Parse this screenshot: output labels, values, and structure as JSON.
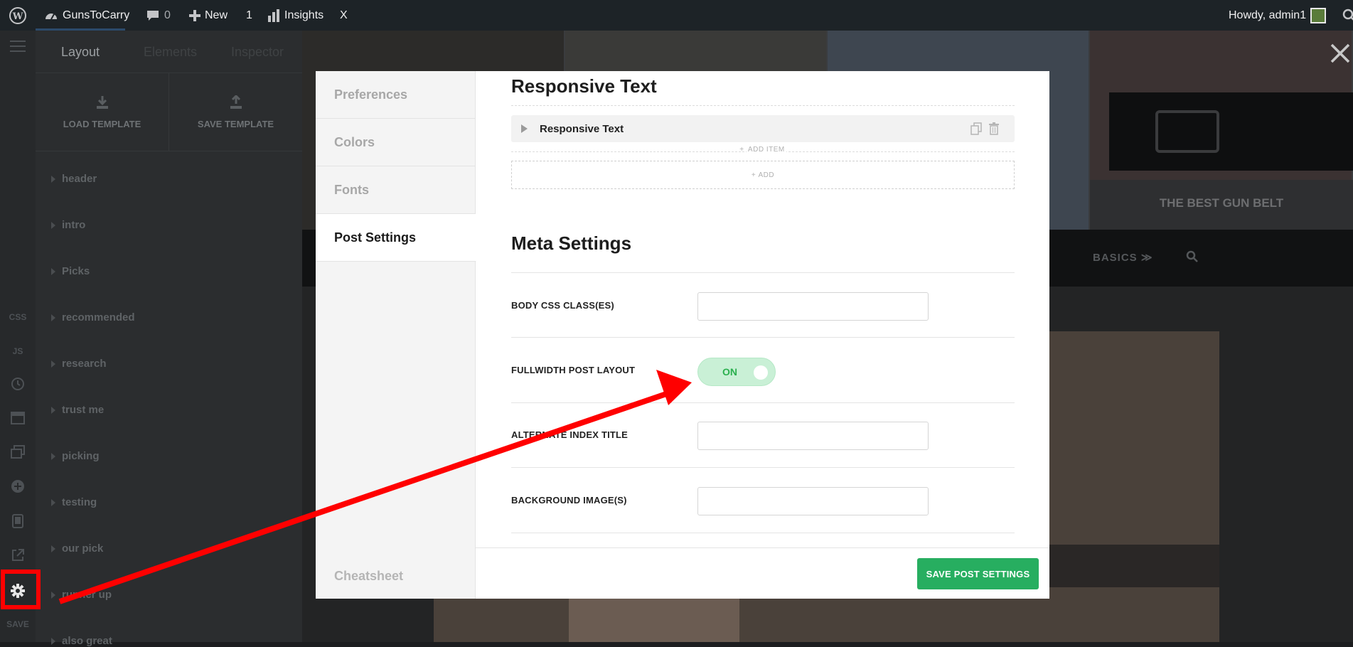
{
  "adminbar": {
    "site_name": "GunsToCarry",
    "comments_count": "0",
    "new_label": "New",
    "updates_count": "1",
    "insights_label": "Insights",
    "x_label": "X",
    "howdy": "Howdy, admin1"
  },
  "rail": {
    "css_label": "CSS",
    "js_label": "JS",
    "save_label": "SAVE"
  },
  "sidebar": {
    "tabs": [
      "Layout",
      "Elements",
      "Inspector"
    ],
    "load_template": "LOAD TEMPLATE",
    "save_template": "SAVE TEMPLATE",
    "items": [
      "header",
      "intro",
      "Picks",
      "recommended",
      "research",
      "trust me",
      "picking",
      "testing",
      "our pick",
      "runner up",
      "also great"
    ]
  },
  "background_page": {
    "hero_caption": "THE BEST GUN BELT",
    "nav_basics": "BASICS"
  },
  "modal": {
    "nav": [
      "Preferences",
      "Colors",
      "Fonts",
      "Post Settings"
    ],
    "active_nav": "Post Settings",
    "cheatsheet": "Cheatsheet",
    "responsive_heading": "Responsive Text",
    "responsive_item": "Responsive Text",
    "add_item": "ADD ITEM",
    "add": "ADD",
    "meta_heading": "Meta Settings",
    "fields": {
      "body_css": {
        "label": "BODY CSS CLASS(ES)",
        "value": ""
      },
      "fullwidth": {
        "label": "FULLWIDTH POST LAYOUT",
        "toggle": "ON"
      },
      "alt_title": {
        "label": "ALTERNATE INDEX TITLE",
        "value": ""
      },
      "bg_images": {
        "label": "BACKGROUND IMAGE(S)",
        "value": ""
      }
    },
    "save_button": "SAVE POST SETTINGS"
  },
  "colors": {
    "accent_green": "#27ae60",
    "toggle_bg": "#c9f0d6",
    "annotation_red": "#ff0000",
    "adminbar_bg": "#1d2327"
  }
}
